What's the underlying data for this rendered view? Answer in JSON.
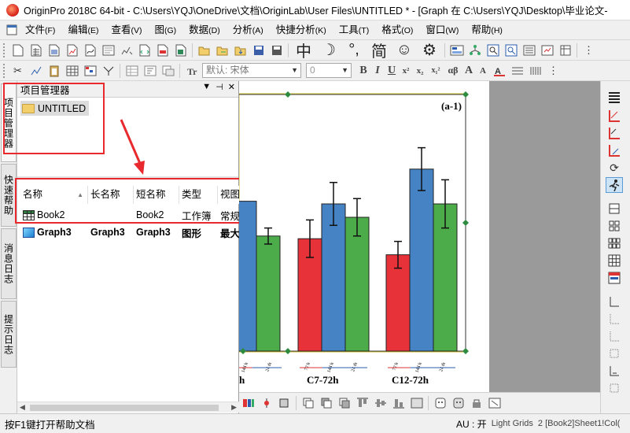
{
  "window": {
    "title": "OriginPro 2018C 64-bit - C:\\Users\\YQJ\\OneDrive\\文档\\OriginLab\\User Files\\UNTITLED * - [Graph 在 C:\\Users\\YQJ\\Desktop\\毕业论文-"
  },
  "menu": {
    "items": [
      {
        "label": "文件",
        "key": "(F)"
      },
      {
        "label": "编辑",
        "key": "(E)"
      },
      {
        "label": "查看",
        "key": "(V)"
      },
      {
        "label": "图",
        "key": "(G)"
      },
      {
        "label": "数据",
        "key": "(D)"
      },
      {
        "label": "分析",
        "key": "(A)"
      },
      {
        "label": "快捷分析",
        "key": "(K)"
      },
      {
        "label": "工具",
        "key": "(T)"
      },
      {
        "label": "格式",
        "key": "(O)"
      },
      {
        "label": "窗口",
        "key": "(W)"
      },
      {
        "label": "帮助",
        "key": "(H)"
      }
    ]
  },
  "ime_bar": {
    "items": [
      "中",
      "☽",
      "°,",
      "简",
      "☺",
      "⚙"
    ]
  },
  "format_toolbar": {
    "font_name": "默认: 宋体",
    "font_size": "0",
    "buttons": [
      "B",
      "I",
      "U",
      "x²",
      "x₂",
      "x₁²",
      "αβ",
      "A",
      "A"
    ]
  },
  "side_tabs": [
    "项目管理器",
    "快速帮助",
    "消息日志",
    "提示日志"
  ],
  "project_explorer": {
    "title": "项目管理器",
    "root_folder": "UNTITLED",
    "columns": [
      "名称",
      "长名称",
      "短名称",
      "类型",
      "视图"
    ],
    "rows": [
      {
        "icon": "workbook-icon",
        "name": "Book2",
        "long_name": "",
        "short_name": "Book2",
        "type": "工作簿",
        "view": "常规"
      },
      {
        "icon": "graph-icon",
        "name": "Graph3",
        "long_name": "Graph3",
        "short_name": "Graph3",
        "type": "图形",
        "view": "最大"
      }
    ]
  },
  "graph": {
    "panel_label": "(a-1)",
    "x_categories": [
      "h",
      "C7-72h",
      "C12-72h"
    ],
    "x_sub_labels": [
      "72 h",
      "144 h",
      "24 th"
    ],
    "colors": {
      "red": "#e8323a",
      "blue": "#4583c5",
      "green": "#4cac4a"
    }
  },
  "chart_data": {
    "type": "bar",
    "title": "(a-1)",
    "categories": [
      "C7-72h",
      "C12-72h"
    ],
    "series": [
      {
        "values": [
          42,
          36
        ]
      },
      {
        "values": [
          55,
          68
        ]
      },
      {
        "values": [
          50,
          55
        ]
      }
    ],
    "error_bars": [
      [
        7,
        5
      ],
      [
        8,
        8
      ],
      [
        7,
        9
      ]
    ],
    "partial_left_group": {
      "blue": 56,
      "green": 43
    }
  },
  "statusbar": {
    "left": "按F1键打开帮助文档",
    "au": "AU : 开",
    "theme": "Light Grids",
    "cell": "2 [Book2]Sheet1!Col("
  }
}
